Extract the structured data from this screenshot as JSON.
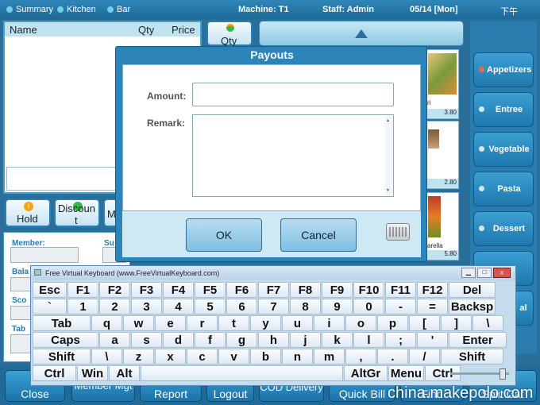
{
  "topbar": {
    "summary": "Summary",
    "kitchen": "Kitchen",
    "bar": "Bar",
    "machine": "Machine: T1",
    "staff": "Staff: Admin",
    "date": "05/14 [Mon]",
    "ime": "下午"
  },
  "order": {
    "col_name": "Name",
    "col_qty": "Qty",
    "col_price": "Price"
  },
  "actions": {
    "qty": "Qty",
    "hold": "Hold",
    "discount_line1": "Discoun",
    "discount_line2": "t",
    "partial": "M"
  },
  "info": {
    "member": "Member:",
    "su": "Su",
    "bala": "Bala",
    "sco": "Sco",
    "tab": "Tab"
  },
  "categories": [
    {
      "label": "Appetizers",
      "selected": true
    },
    {
      "label": "Entree",
      "selected": false
    },
    {
      "label": "Vegetable",
      "selected": false
    },
    {
      "label": "Pasta",
      "selected": false
    },
    {
      "label": "Dessert",
      "selected": false
    },
    {
      "label": "al",
      "selected": false
    }
  ],
  "menu_items": [
    {
      "name": "ri",
      "price": "3.80"
    },
    {
      "name": "",
      "price": "2.80"
    },
    {
      "name": "arella",
      "price": "5.80"
    }
  ],
  "dialog": {
    "title": "Payouts",
    "amount_label": "Amount:",
    "remark_label": "Remark:",
    "amount_value": "",
    "remark_value": "",
    "ok": "OK",
    "cancel": "Cancel"
  },
  "keyboard": {
    "title": "Free Virtual Keyboard (www.FreeVirtualKeyboard.com)",
    "rows": [
      [
        "Esc",
        "F1",
        "F2",
        "F3",
        "F4",
        "F5",
        "F6",
        "F7",
        "F8",
        "F9",
        "F10",
        "F11",
        "F12",
        "Del"
      ],
      [
        "`",
        "1",
        "2",
        "3",
        "4",
        "5",
        "6",
        "7",
        "8",
        "9",
        "0",
        "-",
        "=",
        "Backsp"
      ],
      [
        "Tab",
        "q",
        "w",
        "e",
        "r",
        "t",
        "y",
        "u",
        "i",
        "o",
        "p",
        "[",
        "]",
        "\\"
      ],
      [
        "Caps",
        "a",
        "s",
        "d",
        "f",
        "g",
        "h",
        "j",
        "k",
        "l",
        ";",
        "'",
        "Enter"
      ],
      [
        "Shift",
        "\\",
        "z",
        "x",
        "c",
        "v",
        "b",
        "n",
        "m",
        ",",
        ".",
        "/",
        "Shift"
      ],
      [
        "Ctrl",
        "Win",
        "Alt",
        "",
        "AltGr",
        "Menu",
        "Ctrl"
      ]
    ]
  },
  "bottom": {
    "close": "Close",
    "member": "Member Mgt",
    "report": "Report",
    "logout": "Logout",
    "delivery": "COD Delivery",
    "quickbill": "Quick Bill",
    "find": "Find",
    "splitcat": "Split Cat"
  },
  "watermark": "china.makepolo.com",
  "colors": {
    "accent": "#2a7cae",
    "dialog_header": "#2c84b8",
    "highlight": "#e07040"
  }
}
